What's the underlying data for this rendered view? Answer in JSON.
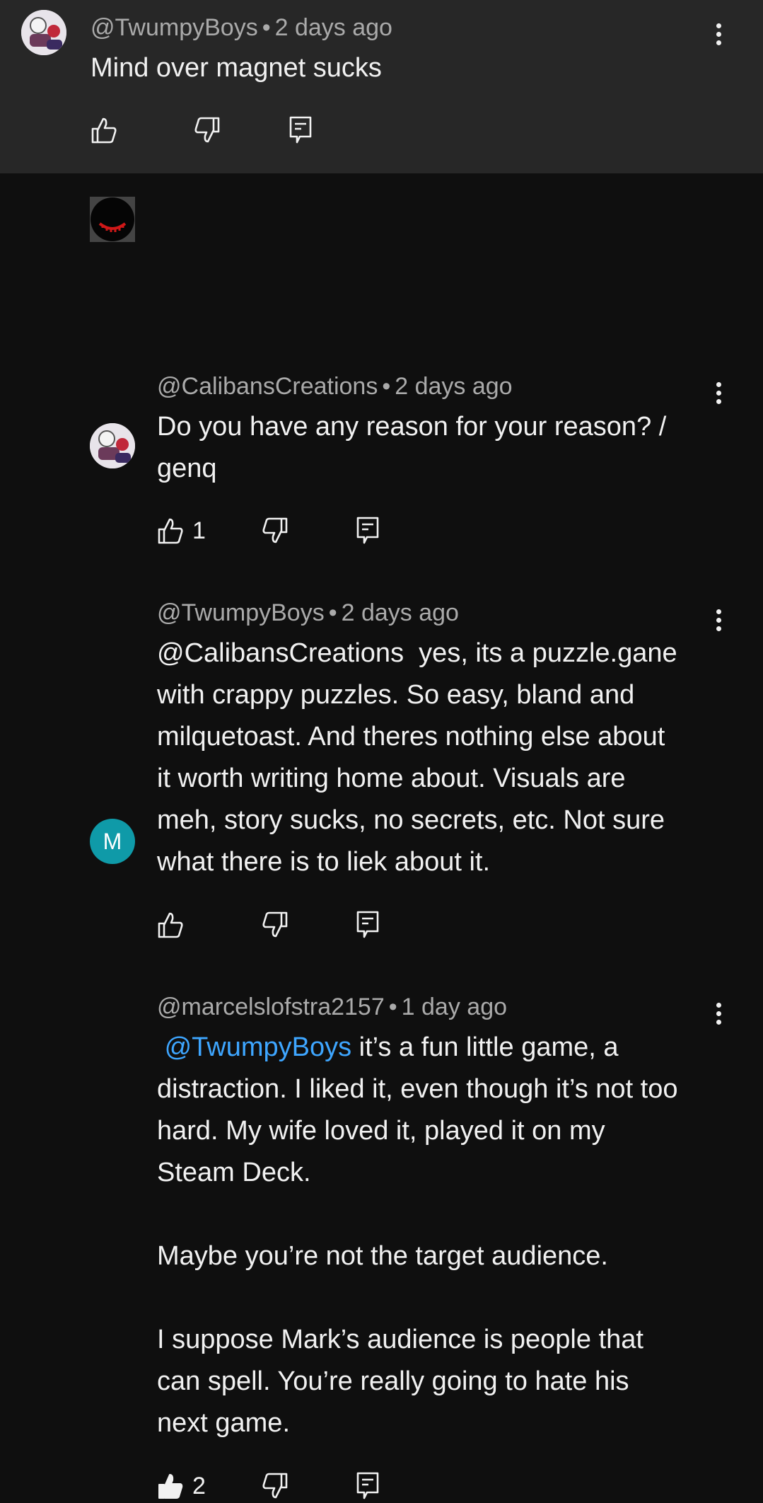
{
  "comments": [
    {
      "author": "@TwumpyBoys",
      "sep": "•",
      "time": "2 days ago",
      "text": "Mind over magnet sucks",
      "like_count": "",
      "liked": false
    },
    {
      "author": "@CalibansCreations",
      "sep": "•",
      "time": "2 days ago",
      "text": "Do you have any reason for your reason? /\ngenq",
      "like_count": "1",
      "liked": false
    },
    {
      "author": "@TwumpyBoys",
      "sep": "•",
      "time": "2 days ago",
      "text": "@CalibansCreations  yes, its a puzzle.gane\nwith crappy puzzles. So easy, bland and\nmilquetoast. And theres nothing else about\nit worth writing home about. Visuals are\nmeh, story sucks, no secrets, etc. Not sure\nwhat there is to liek about it.",
      "like_count": "",
      "liked": false
    },
    {
      "author": "@marcelslofstra2157",
      "sep": "•",
      "time": "1 day ago",
      "avatar_letter": "M",
      "mention": "@TwumpyBoys",
      "text": " it’s a fun little game, a\ndistraction. I liked it, even though it’s not too\nhard. My wife loved it, played it on my\nSteam Deck.\n\nMaybe you’re not the target audience.\n\nI suppose Mark’s audience is people that\ncan spell. You’re really going to hate his\nnext game.",
      "like_count": "2",
      "liked": true
    }
  ],
  "icons": {
    "like": "thumb-up-icon",
    "dislike": "thumb-down-icon",
    "reply": "reply-icon",
    "more": "more-vert-icon"
  },
  "colors": {
    "background": "#0f0f0f",
    "highlight_background": "#272727",
    "meta_text": "#aaaaaa",
    "body_text": "#f1f1f1",
    "mention": "#3ea6ff",
    "avatar_m": "#0f9aa8"
  }
}
